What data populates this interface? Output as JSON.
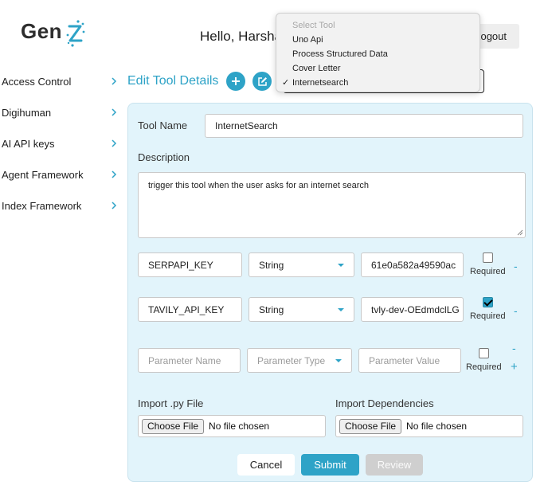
{
  "app": {
    "logo_text": "Gen"
  },
  "header": {
    "greeting": "Hello, Harsha",
    "logout_label": "Logout"
  },
  "sidebar": {
    "items": [
      {
        "label": "Access Control"
      },
      {
        "label": "Digihuman"
      },
      {
        "label": "AI API keys"
      },
      {
        "label": "Agent Framework"
      },
      {
        "label": "Index Framework"
      }
    ]
  },
  "page": {
    "title": "Edit Tool Details"
  },
  "tool_select": {
    "options": [
      {
        "label": "Select Tool",
        "disabled": true,
        "selected": false
      },
      {
        "label": "Uno Api",
        "disabled": false,
        "selected": false
      },
      {
        "label": "Process Structured Data",
        "disabled": false,
        "selected": false
      },
      {
        "label": "Cover Letter",
        "disabled": false,
        "selected": false
      },
      {
        "label": "Internetsearch",
        "disabled": false,
        "selected": true
      }
    ]
  },
  "form": {
    "tool_name_label": "Tool Name",
    "tool_name_value": "InternetSearch",
    "description_label": "Description",
    "description_value": "trigger this tool when the user asks for an internet search",
    "parameters": [
      {
        "name": "SERPAPI_KEY",
        "type": "String",
        "value": "61e0a582a49590ac",
        "required": false
      },
      {
        "name": "TAVILY_API_KEY",
        "type": "String",
        "value": "tvly-dev-OEdmdclLG",
        "required": true
      }
    ],
    "new_parameter": {
      "name_placeholder": "Parameter Name",
      "type_placeholder": "Parameter Type",
      "value_placeholder": "Parameter Value",
      "required": false
    },
    "required_label": "Required",
    "import_py_label": "Import .py File",
    "import_deps_label": "Import Dependencies",
    "choose_file_label": "Choose File",
    "no_file_label": "No file chosen",
    "cancel_label": "Cancel",
    "submit_label": "Submit",
    "review_label": "Review"
  },
  "colors": {
    "accent": "#2ea3c7",
    "panel_bg": "#e2f4fb"
  }
}
